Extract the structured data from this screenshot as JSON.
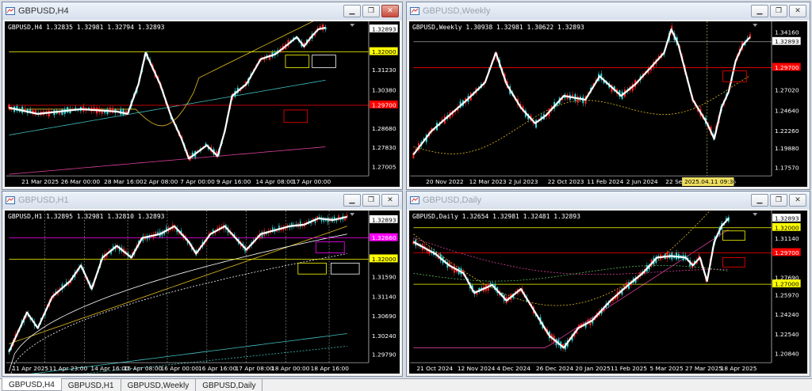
{
  "windows": [
    {
      "id": "h4",
      "title": "GBPUSD,H4",
      "info": "GBPUSD,H4  1.32835 1.32981 1.32794 1.32893",
      "price_labels": [
        {
          "text": "1.32893",
          "kind": "current"
        },
        {
          "text": "1.32000",
          "kind": "yellow"
        },
        {
          "text": "1.31230",
          "kind": "plain"
        },
        {
          "text": "1.30380",
          "kind": "plain"
        },
        {
          "text": "1.29700",
          "kind": "red"
        },
        {
          "text": "1.28680",
          "kind": "plain"
        },
        {
          "text": "1.27830",
          "kind": "plain"
        },
        {
          "text": "1.27005",
          "kind": "plain"
        }
      ],
      "time_labels": [
        "21 Mar 2025",
        "26 Mar 00:00",
        "28 Mar 16:00",
        "2 Apr 08:00",
        "7 Apr 00:00",
        "9 Apr 16:00",
        "14 Apr 08:00",
        "17 Apr 00:00"
      ]
    },
    {
      "id": "weekly",
      "title": "GBPUSD,Weekly",
      "info": "GBPUSD,Weekly  1.30938 1.32981 1.30622 1.32893",
      "price_labels": [
        {
          "text": "1.34160",
          "kind": "plain"
        },
        {
          "text": "1.32893",
          "kind": "current"
        },
        {
          "text": "1.29700",
          "kind": "red"
        },
        {
          "text": "1.27020",
          "kind": "plain"
        },
        {
          "text": "1.24640",
          "kind": "plain"
        },
        {
          "text": "1.22260",
          "kind": "plain"
        },
        {
          "text": "1.19880",
          "kind": "plain"
        },
        {
          "text": "1.17570",
          "kind": "plain"
        }
      ],
      "time_labels": [
        "20 Nov 2022",
        "12 Mar 2023",
        "2 Jul 2023",
        "22 Oct 2023",
        "11 Feb 2024",
        "2 Jun 2024",
        "22 Sep 2024",
        "12 Jan 2025"
      ],
      "crosshair_label": "2025.04.11 09:30"
    },
    {
      "id": "h1",
      "title": "GBPUSD,H1",
      "info": "GBPUSD,H1  1.32895 1.32981 1.32810 1.32893",
      "price_labels": [
        {
          "text": "1.32893",
          "kind": "current"
        },
        {
          "text": "1.32660",
          "kind": "magenta"
        },
        {
          "text": "1.32000",
          "kind": "yellow"
        },
        {
          "text": "1.31590",
          "kind": "plain"
        },
        {
          "text": "1.31140",
          "kind": "plain"
        },
        {
          "text": "1.30690",
          "kind": "plain"
        },
        {
          "text": "1.30240",
          "kind": "plain"
        },
        {
          "text": "1.29790",
          "kind": "plain"
        }
      ],
      "time_labels": [
        "11 Apr 2025",
        "11 Apr 23:00",
        "14 Apr 16:00",
        "15 Apr 08:00",
        "16 Apr 00:00",
        "16 Apr 16:00",
        "17 Apr 08:00",
        "18 Apr 00:00",
        "18 Apr 16:00"
      ]
    },
    {
      "id": "daily",
      "title": "GBPUSD,Daily",
      "info": "GBPUSD,Daily  1.32654 1.32981 1.32481 1.32893",
      "price_labels": [
        {
          "text": "1.32893",
          "kind": "current"
        },
        {
          "text": "1.32000",
          "kind": "yellow"
        },
        {
          "text": "1.31140",
          "kind": "plain"
        },
        {
          "text": "1.29700",
          "kind": "red"
        },
        {
          "text": "1.27690",
          "kind": "plain"
        },
        {
          "text": "1.27000",
          "kind": "yellow"
        },
        {
          "text": "1.25970",
          "kind": "plain"
        },
        {
          "text": "1.24240",
          "kind": "plain"
        },
        {
          "text": "1.22540",
          "kind": "plain"
        },
        {
          "text": "1.20840",
          "kind": "plain"
        }
      ],
      "time_labels": [
        "21 Oct 2024",
        "12 Nov 2024",
        "4 Dec 2024",
        "26 Dec 2024",
        "20 Jan 2025",
        "11 Feb 2025",
        "5 Mar 2025",
        "27 Mar 2025",
        "18 Apr 2025"
      ]
    }
  ],
  "tabs": [
    {
      "label": "GBPUSD,H4",
      "active": true
    },
    {
      "label": "GBPUSD,H1",
      "active": false
    },
    {
      "label": "GBPUSD,Weekly",
      "active": false
    },
    {
      "label": "GBPUSD,Daily",
      "active": false
    }
  ],
  "controls": {
    "minimize": "▁",
    "restore": "❐",
    "close": "✕"
  },
  "colors": {
    "chart_bg": "#000000",
    "bull": "#ff2a2a",
    "bear": "#35d7d7",
    "zigzag": "#ffffff",
    "ma_fast": "#e8c020",
    "ma_slow": "#40c0c0",
    "ma_long": "#e040a0",
    "yellow_level": "#ffff00",
    "red_level": "#ff0000",
    "magenta_level": "#ff00ff"
  }
}
